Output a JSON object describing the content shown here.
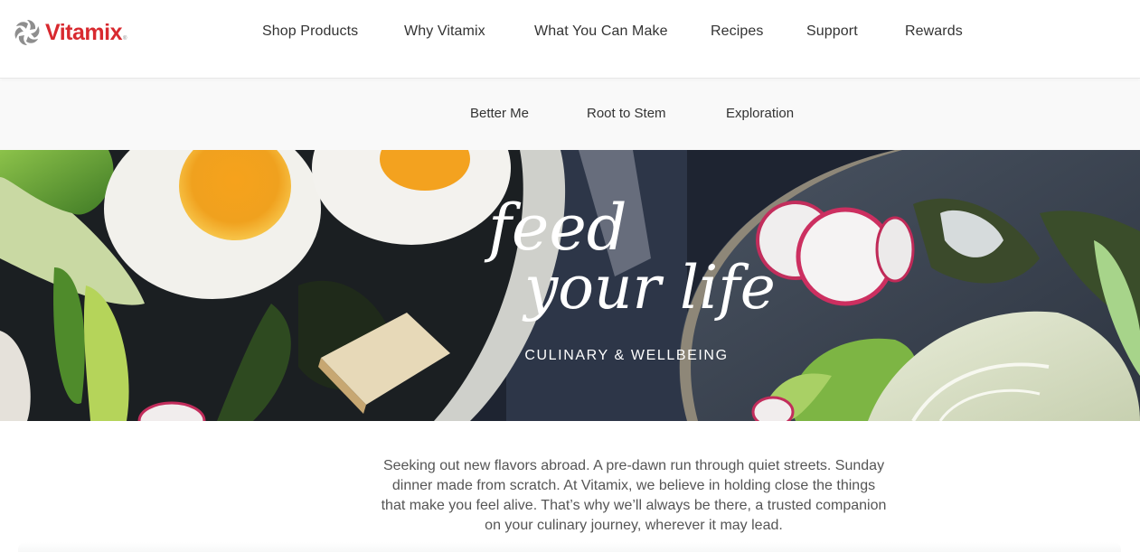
{
  "brand": {
    "name": "Vitamix",
    "registered_mark": "®",
    "color": "#d8292f"
  },
  "main_nav": {
    "items": [
      {
        "label": "Shop Products"
      },
      {
        "label": "Why Vitamix"
      },
      {
        "label": "What You Can Make"
      },
      {
        "label": "Recipes"
      },
      {
        "label": "Support"
      },
      {
        "label": "Rewards"
      }
    ]
  },
  "sub_nav": {
    "items": [
      {
        "label": "Better Me"
      },
      {
        "label": "Root to Stem"
      },
      {
        "label": "Exploration"
      }
    ]
  },
  "hero": {
    "script_title_line1": "feed",
    "script_title_line2": "your life",
    "trademark": "™",
    "subtitle": "CULINARY & WELLBEING",
    "image_description": "Salad with soft-boiled eggs, croutons, radishes and lettuce on dark plates"
  },
  "intro": {
    "text": "Seeking out new flavors abroad. A pre-dawn run through quiet streets. Sunday dinner made from scratch. At Vitamix, we believe in holding close the things that make you feel alive. That’s why we’ll always be there, a trusted companion on your culinary journey, wherever it may lead."
  }
}
